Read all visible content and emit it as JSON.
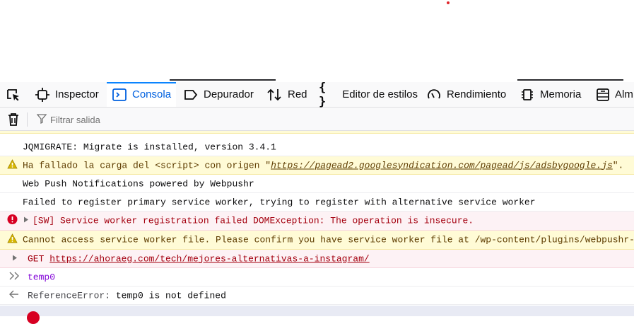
{
  "toolbar": {
    "tools": [
      {
        "label": ""
      },
      {
        "label": "Inspector"
      },
      {
        "label": "Consola"
      },
      {
        "label": "Depurador"
      },
      {
        "label": "Red"
      },
      {
        "label": "Editor de estilos"
      },
      {
        "label": "Rendimiento"
      },
      {
        "label": "Memoria"
      },
      {
        "label": "Alm"
      }
    ],
    "selected": "Consola",
    "accent_color": "#0a84ff"
  },
  "filter": {
    "placeholder": "Filtrar salida"
  },
  "console": {
    "messages": [
      {
        "level": "log",
        "text": "JQMIGRATE: Migrate is installed, version 3.4.1"
      },
      {
        "level": "warning",
        "prefix": "Ha fallado la carga del <script> con origen \"",
        "url": "https://pagead2.googlesyndication.com/pagead/js/adsbygoogle.js",
        "suffix": "\"."
      },
      {
        "level": "log",
        "text": "Web Push Notifications powered by Webpushr"
      },
      {
        "level": "log",
        "text": "Failed to register primary service worker, trying to register with alternative service worker"
      },
      {
        "level": "error",
        "text": "[SW] Service worker registration failed DOMException: The operation is insecure."
      },
      {
        "level": "warning",
        "text": "Cannot access service worker file. Please confirm you have service worker file at  /wp-content/plugins/webpushr-web"
      },
      {
        "level": "error",
        "method": "GET",
        "url": "https://ahoraeg.com/tech/mejores-alternativas-a-instagram/"
      }
    ],
    "input": "temp0",
    "result": {
      "type": "ReferenceError:",
      "text": "temp0 is not defined"
    }
  },
  "colors": {
    "warning_bg": "#fffbd6",
    "error_bg": "#fdf2f5",
    "input_color": "#8000d7"
  }
}
